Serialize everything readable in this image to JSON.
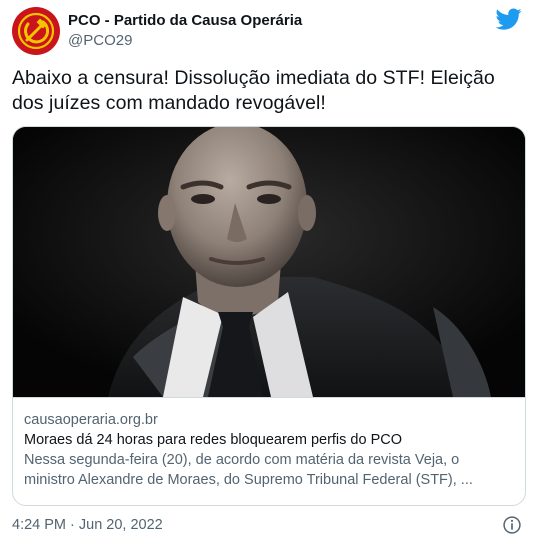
{
  "author": {
    "display_name": "PCO - Partido da Causa Operária",
    "handle": "@PCO29"
  },
  "icons": {
    "avatar": "hammer-sickle-icon",
    "brand": "twitter-bird-icon",
    "info": "info-icon"
  },
  "colors": {
    "avatar_bg": "#c8141a",
    "emblem": "#f5c400",
    "twitter_blue": "#1d9bf0"
  },
  "tweet": {
    "text": "Abaixo a censura! Dissolução imediata do STF! Eleição dos juízes com mandado revogável!"
  },
  "card": {
    "domain": "causaoperaria.org.br",
    "title": "Moraes dá 24 horas para redes bloquearem perfis do PCO",
    "description_line1": "Nessa segunda-feira (20), de acordo com matéria da revista Veja, o",
    "description_line2": "ministro Alexandre de Moraes, do Supremo Tribunal Federal (STF), ..."
  },
  "footer": {
    "timestamp": "4:24 PM · Jun 20, 2022"
  }
}
